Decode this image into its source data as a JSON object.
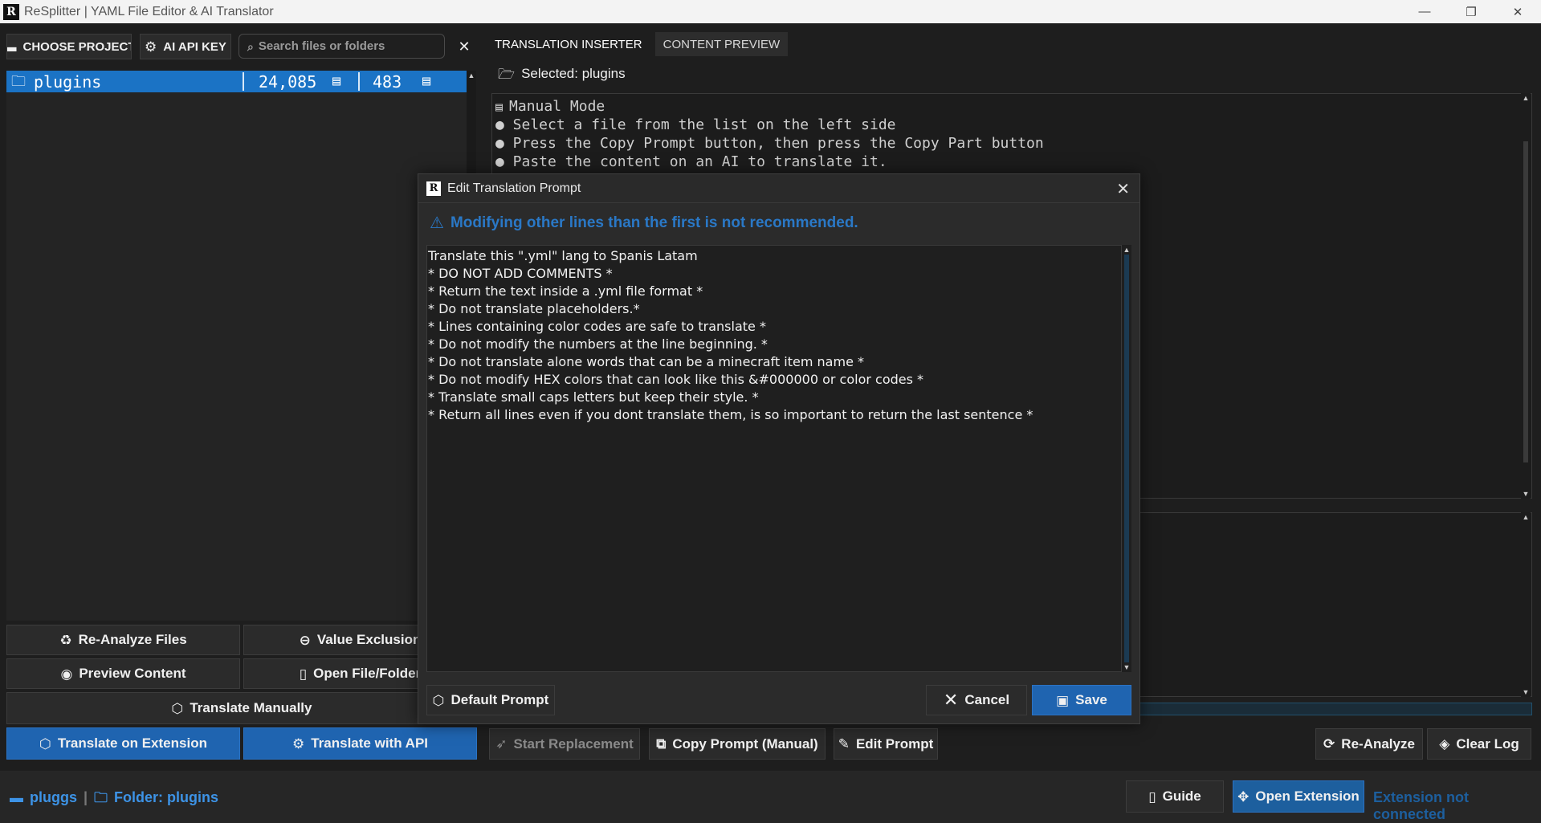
{
  "window": {
    "logo": "R",
    "title": "ReSplitter | YAML File Editor & AI Translator",
    "minimize": "—",
    "restore": "❐",
    "close": "✕"
  },
  "toolbar": {
    "choose_project": "CHOOSE PROJECT",
    "ai_api_key": "AI API KEY",
    "search_placeholder": "Search files or folders",
    "clear_search": "✕"
  },
  "file_tree": {
    "items": [
      {
        "name": "plugins",
        "lines": "24,085",
        "files": "483"
      }
    ]
  },
  "left_actions": {
    "reanalyze_files": "Re-Analyze Files",
    "value_exclusion": "Value Exclusion",
    "preview_content": "Preview Content",
    "open_file_folder": "Open File/Folder",
    "translate_manually": "Translate Manually",
    "translate_on_extension": "Translate on Extension",
    "translate_with_api": "Translate with API"
  },
  "tabs": [
    {
      "label": "TRANSLATION INSERTER",
      "active": true
    },
    {
      "label": "CONTENT PREVIEW",
      "active": false
    }
  ],
  "main": {
    "selected_label": "Selected: plugins",
    "info_lines": [
      "Manual Mode",
      "● Select a file from the list on the left side",
      "● Press the Copy Prompt button, then press the Copy Part button",
      "● Paste the content on an AI to translate it."
    ]
  },
  "bottom_actions": {
    "start_replacement": "Start Replacement",
    "copy_prompt": "Copy Prompt (Manual)",
    "edit_prompt": "Edit Prompt",
    "reanalyze": "Re-Analyze",
    "clear_log": "Clear Log"
  },
  "status": {
    "user": "pluggs",
    "separator": "|",
    "folder": "Folder: plugins",
    "guide": "Guide",
    "open_extension": "Open Extension",
    "extension_status": "Extension not connected"
  },
  "dialog": {
    "logo": "R",
    "title": "Edit Translation Prompt",
    "close": "✕",
    "warning": "Modifying other lines than the first is not recommended.",
    "prompt_text": "Translate this \".yml\" lang to Spanis Latam\n* DO NOT ADD COMMENTS *\n* Return the text inside a .yml file format *\n* Do not translate placeholders.*\n* Lines containing color codes are safe to translate *\n* Do not modify the numbers at the line beginning. *\n* Do not translate alone words that can be a minecraft item name *\n* Do not modify HEX colors that can look like this &#000000 or color codes *\n* Translate small caps letters but keep their style. *\n* Return all lines even if you dont translate them, is so important to return the last sentence *",
    "default_prompt": "Default Prompt",
    "cancel": "Cancel",
    "save": "Save"
  },
  "colors": {
    "accent": "#1f64b0",
    "selection": "#1b73c5",
    "warning": "#2a78c6",
    "background": "#1e1e1e"
  }
}
